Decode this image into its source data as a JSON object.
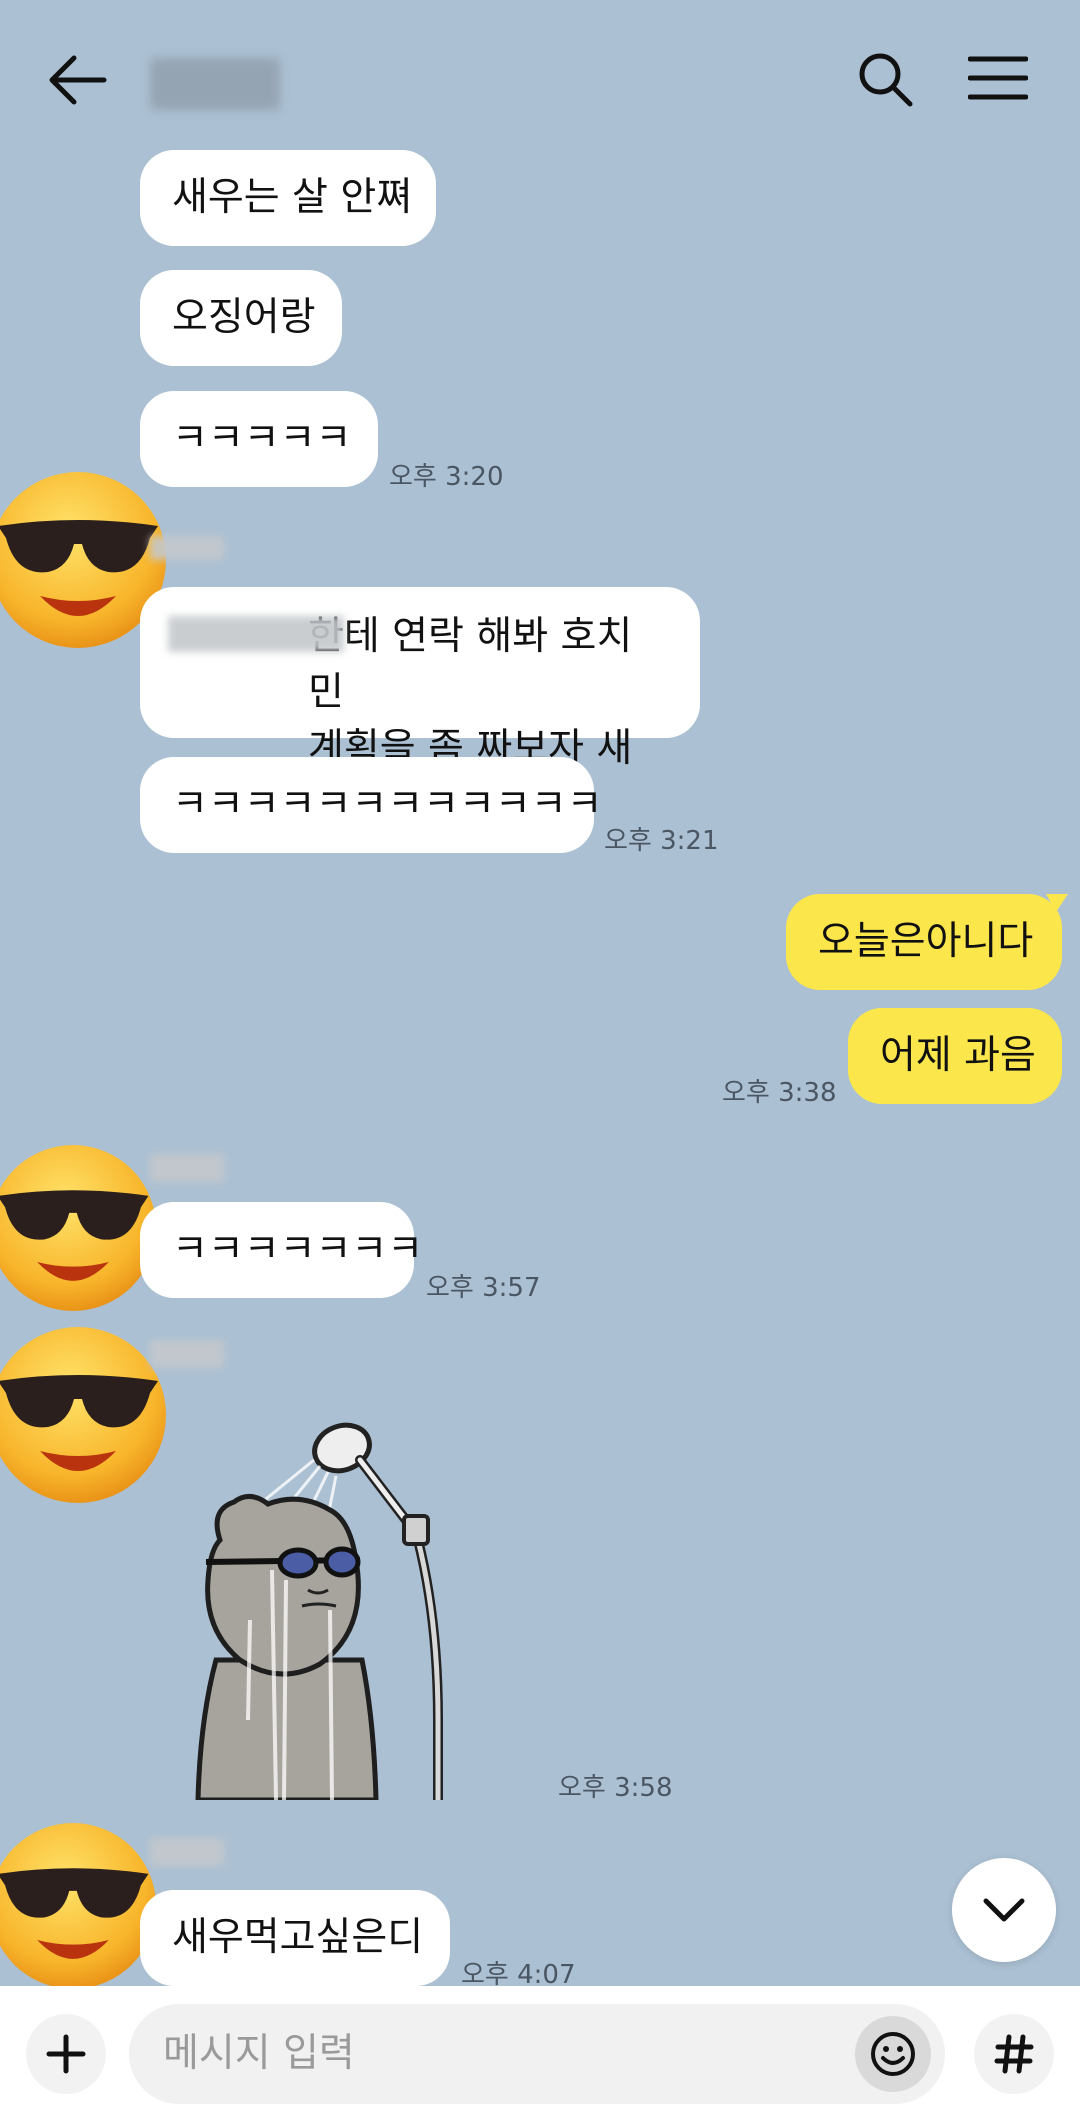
{
  "header": {
    "back_icon": "arrow-left-icon",
    "search_icon": "search-icon",
    "menu_icon": "hamburger-menu-icon"
  },
  "messages": [
    {
      "text": "새우는 살 안쪄"
    },
    {
      "text": "오징어랑"
    },
    {
      "text": "ㅋㅋㅋㅋㅋ",
      "time": "오후 3:20"
    },
    {
      "text": "한테 연락 해봐 호치민\n계획을 좀 짜보자 새우먹으면서"
    },
    {
      "text": "ㅋㅋㅋㅋㅋㅋㅋㅋㅋㅋㅋㅋ",
      "time": "오후 3:21"
    },
    {
      "text": "오늘은아니다",
      "mine": true
    },
    {
      "text": "어제 과음",
      "mine": true,
      "time": "오후 3:38"
    },
    {
      "text": "ㅋㅋㅋㅋㅋㅋㅋ",
      "time": "오후 3:57"
    },
    {
      "sticker": "shower-bear-sticker",
      "time": "오후 3:58"
    },
    {
      "text": "새우먹고싶은디",
      "time": "오후 4:07"
    }
  ],
  "avatar_emoji": "😎",
  "composer": {
    "add_icon": "plus-icon",
    "placeholder": "메시지 입력",
    "emoji_icon": "emoji-icon",
    "hash_icon": "hash-icon"
  },
  "scroll_down_icon": "chevron-down-icon",
  "colors": {
    "background": "#abc0d3",
    "my_bubble": "#fbe74b",
    "other_bubble": "#ffffff"
  }
}
